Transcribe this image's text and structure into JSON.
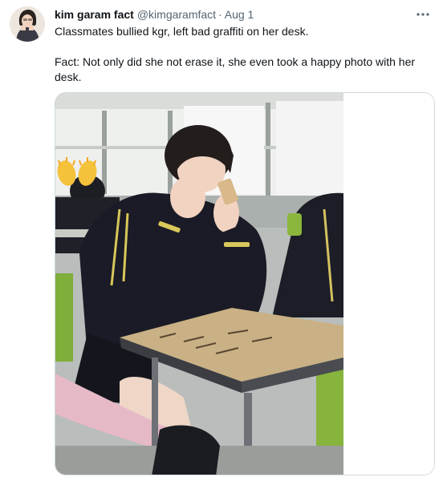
{
  "tweet": {
    "author": {
      "display_name": "kim garam fact",
      "handle": "@kimgaramfact"
    },
    "separator": "·",
    "date": "Aug 1",
    "paragraphs": [
      "Classmates bullied kgr, left bad graffiti on her desk.",
      "Fact: Not only did she not erase it, she even took a happy photo with her desk."
    ],
    "icons": {
      "more": "more-dots-icon",
      "emoji": "clapping-hands-emoji"
    },
    "colors": {
      "text": "#0f1419",
      "secondary": "#536471",
      "border": "#cfd9de"
    }
  }
}
